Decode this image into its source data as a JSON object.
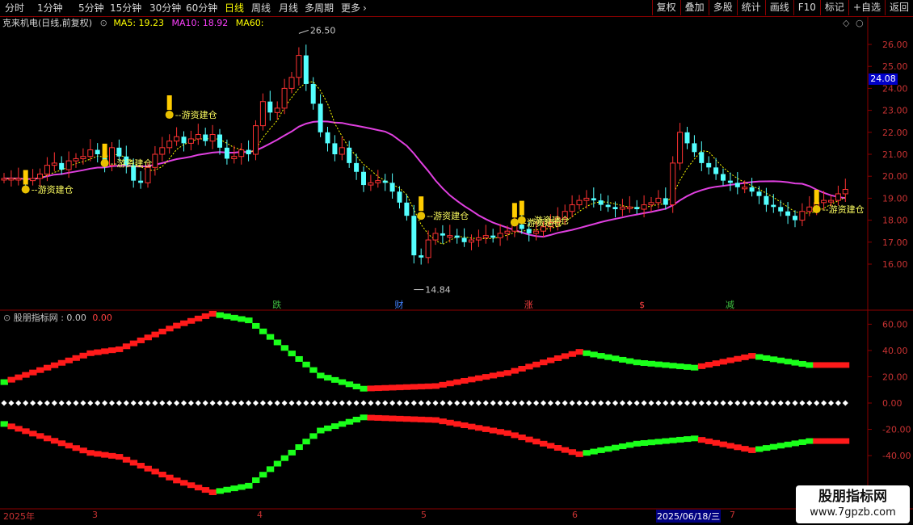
{
  "toolbar": {
    "timeframes": [
      "分时",
      "1分钟",
      "5分钟",
      "15分钟",
      "30分钟",
      "60分钟",
      "日线",
      "周线",
      "月线",
      "多周期",
      "更多"
    ],
    "active_timeframe": "日线",
    "more_arrow": "›",
    "buttons": [
      "复权",
      "叠加",
      "多股",
      "统计",
      "画线",
      "F10",
      "标记",
      "+自选",
      "返回"
    ]
  },
  "stock": {
    "title": "克来机电(日线,前复权)",
    "ma5_label": "MA5: 19.23",
    "ma10_label": "MA10: 18.92",
    "ma60_label": "MA60:",
    "ma5_color": "#ffff00",
    "ma10_color": "#ff00ff",
    "ma60_color": "#ffff00",
    "current_price": "24.08",
    "high_label": "26.50",
    "low_label": "14.84",
    "signal_label": "游资建仓",
    "candle_up_color": "#ff3232",
    "candle_down_color": "#54ffff",
    "ma_line_color": "#e040e0"
  },
  "price_axis": [
    "26.00",
    "25.00",
    "24.00",
    "23.00",
    "22.00",
    "21.00",
    "20.00",
    "19.00",
    "18.00",
    "17.00",
    "16.00"
  ],
  "event_markers": [
    {
      "text": "跌",
      "color": "#40c040"
    },
    {
      "text": "财",
      "color": "#4080ff"
    },
    {
      "text": "涨",
      "color": "#ff4040"
    },
    {
      "text": "$",
      "color": "#ff4040"
    },
    {
      "text": "减",
      "color": "#40c040"
    }
  ],
  "indicator": {
    "title": "股朋指标网 : 0.00",
    "value": "0.00",
    "axis": [
      "60.00",
      "40.00",
      "20.00",
      "0.00",
      "-20.00",
      "-40.00"
    ],
    "up_color": "#ff1a1a",
    "down_color": "#1aff1a"
  },
  "dates": {
    "year": "2025年",
    "months": [
      "3",
      "4",
      "5",
      "6",
      "7"
    ],
    "selected": "2025/06/18/三"
  },
  "watermark": {
    "line1": "股朋指标网",
    "line2": "www.7gpzb.com"
  }
}
